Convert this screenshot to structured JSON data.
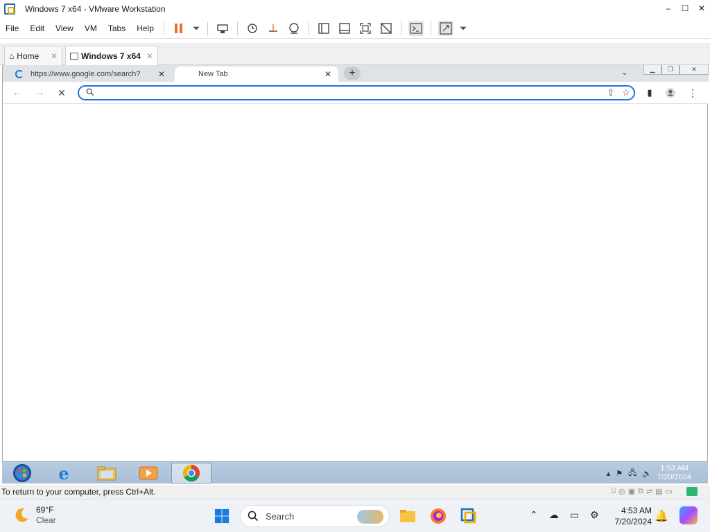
{
  "vmware": {
    "window_title": "Windows 7 x64 - VMware Workstation",
    "controls": {
      "minimize": "–",
      "maximize": "☐",
      "close": "✕"
    },
    "menu": [
      "File",
      "Edit",
      "View",
      "VM",
      "Tabs",
      "Help"
    ],
    "tabs": [
      {
        "label": "Home",
        "active": false
      },
      {
        "label": "Windows 7 x64",
        "active": true
      }
    ],
    "status_text": "To return to your computer, press Ctrl+Alt."
  },
  "chrome": {
    "tabs": [
      {
        "label": "https://www.google.com/search?",
        "loading": true,
        "active": false
      },
      {
        "label": "New Tab",
        "loading": false,
        "active": true
      }
    ],
    "omnibox": {
      "value": "",
      "placeholder": ""
    }
  },
  "win7": {
    "clock_time": "1:53 AM",
    "clock_date": "7/20/2024",
    "taskbar_apps": [
      "start-orb",
      "internet-explorer",
      "windows-explorer",
      "media-player",
      "chrome"
    ]
  },
  "win11": {
    "weather_temp": "69°F",
    "weather_desc": "Clear",
    "search_label": "Search",
    "clock_time": "4:53 AM",
    "clock_date": "7/20/2024"
  }
}
